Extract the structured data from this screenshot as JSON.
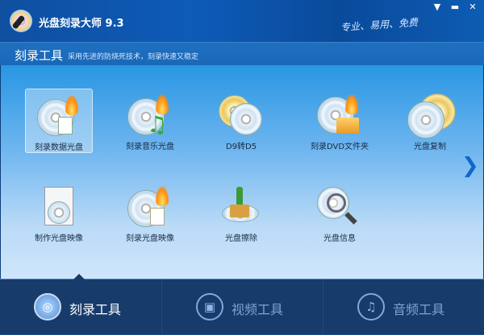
{
  "window": {
    "title": "光盘刻录大师 9.3",
    "slogan": "专业、易用、免费",
    "menu_icon": "menu-icon",
    "minimize_icon": "minimize-icon",
    "close_icon": "close-icon"
  },
  "section": {
    "title": "刻录工具",
    "description": "采用先进的防烧死技术，刻录快速又稳定"
  },
  "tools": [
    {
      "label": "刻录数据光盘",
      "selected": true
    },
    {
      "label": "刻录音乐光盘"
    },
    {
      "label": "D9转D5"
    },
    {
      "label": "刻录DVD文件夹"
    },
    {
      "label": "光盘复制"
    },
    {
      "label": "制作光盘映像"
    },
    {
      "label": "刻录光盘映像"
    },
    {
      "label": "光盘擦除"
    },
    {
      "label": "光盘信息"
    }
  ],
  "nav": [
    {
      "label": "刻录工具",
      "active": true
    },
    {
      "label": "视频工具"
    },
    {
      "label": "音频工具"
    }
  ]
}
